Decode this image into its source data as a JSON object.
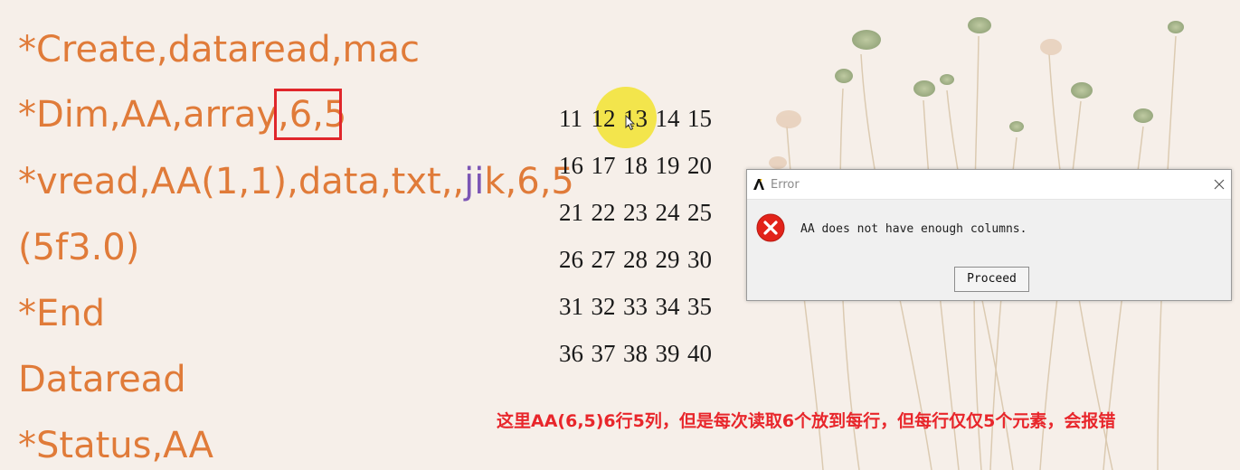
{
  "slide": {
    "code": {
      "line1": "*Create,dataread,mac",
      "line2_prefix": "*Dim,AA,array,",
      "line2_highlight": "6,5",
      "line3_prefix": "*vread,AA(1,1),data,txt,,",
      "line3_purple": "ji",
      "line3_suffix": "k,6,5",
      "line4": "(5f3.0)",
      "line5": "*End",
      "line6": "Dataread",
      "line7": "*Status,AA"
    },
    "matrix": {
      "rows": [
        [
          "11",
          "12",
          "13",
          "14",
          "15"
        ],
        [
          "16",
          "17",
          "18",
          "19",
          "20"
        ],
        [
          "21",
          "22",
          "23",
          "24",
          "25"
        ],
        [
          "26",
          "27",
          "28",
          "29",
          "30"
        ],
        [
          "31",
          "32",
          "33",
          "34",
          "35"
        ],
        [
          "36",
          "37",
          "38",
          "39",
          "40"
        ]
      ]
    },
    "caption": "这里AA(6,5)6行5列，但是每次读取6个放到每行，但每行仅仅5个元素，会报错"
  },
  "dialog": {
    "title": "Error",
    "message": "AA does not have enough columns.",
    "proceed_label": "Proceed",
    "logo_icon": "ansys-logo-icon",
    "error_icon": "error-x-icon",
    "close_icon": "close-icon"
  },
  "colors": {
    "code": "#e07b39",
    "highlight_box": "#e0262b",
    "purple": "#7b55b5",
    "caption": "#e8262b",
    "cursor_spot": "#f3e33b"
  }
}
